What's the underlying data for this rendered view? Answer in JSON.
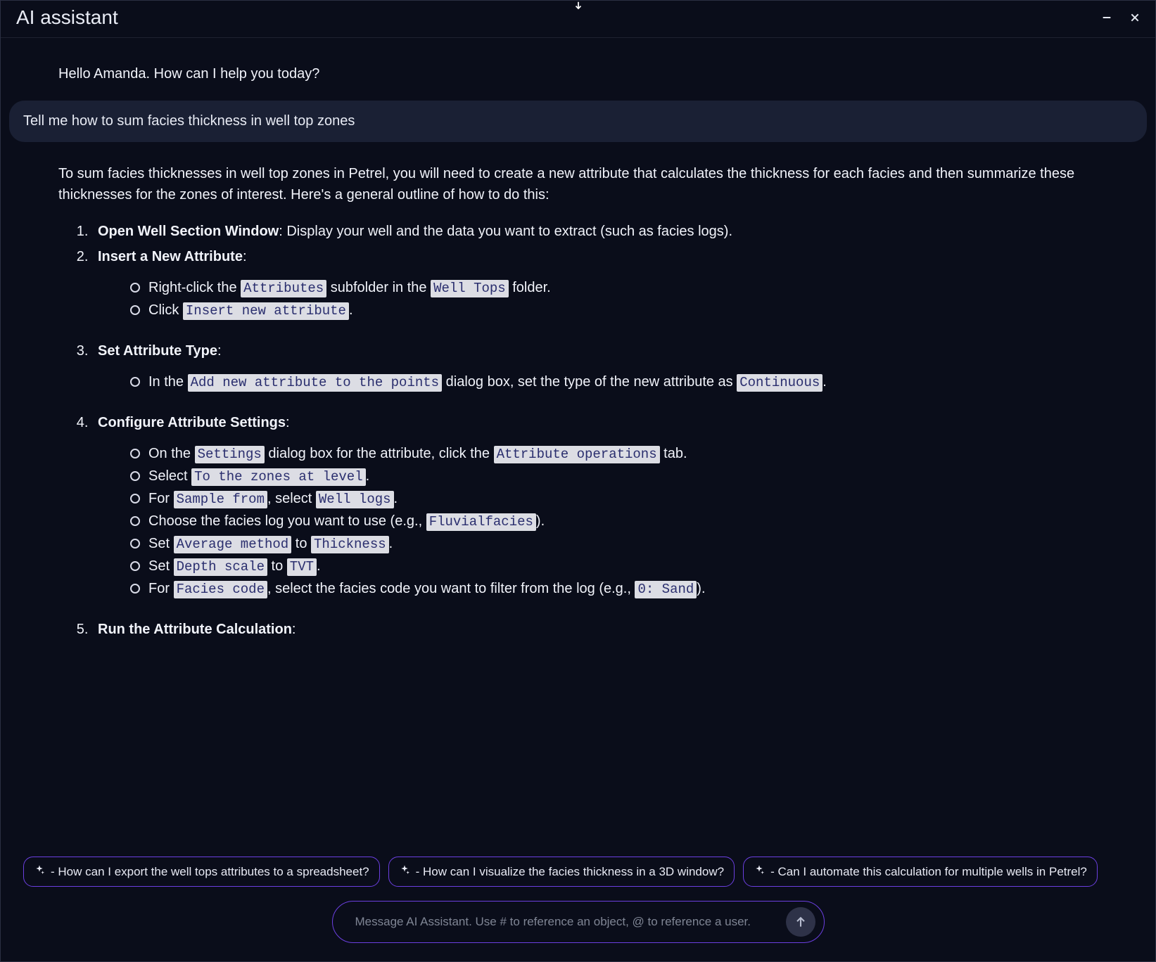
{
  "window": {
    "title": "AI assistant"
  },
  "chat": {
    "greeting": "Hello Amanda. How can I help you today?",
    "user_message": "Tell me how to sum facies thickness in well top zones",
    "answer_intro": "To sum facies thicknesses in well top zones in Petrel, you will need to create a new attribute that calculates the thickness for each facies and then summarize these thicknesses for the zones of interest. Here's a general outline of how to do this:",
    "steps": {
      "s1_title": "Open Well Section Window",
      "s1_tail": ": Display your well and the data you want to extract (such as facies logs).",
      "s2_title": "Insert a New Attribute",
      "s2_tail": ":",
      "s2_a_pre": "Right-click the ",
      "s2_a_c1": "Attributes",
      "s2_a_mid": " subfolder in the ",
      "s2_a_c2": "Well Tops",
      "s2_a_post": " folder.",
      "s2_b_pre": "Click ",
      "s2_b_c1": "Insert new attribute",
      "s2_b_post": ".",
      "s3_title": "Set Attribute Type",
      "s3_tail": ":",
      "s3_a_pre": "In the ",
      "s3_a_c1": "Add new attribute to the points",
      "s3_a_mid": " dialog box, set the type of the new attribute as ",
      "s3_a_c2": "Continuous",
      "s3_a_post": ".",
      "s4_title": "Configure Attribute Settings",
      "s4_tail": ":",
      "s4_a_pre": "On the ",
      "s4_a_c1": "Settings",
      "s4_a_mid": " dialog box for the attribute, click the ",
      "s4_a_c2": "Attribute operations",
      "s4_a_post": " tab.",
      "s4_b_pre": "Select ",
      "s4_b_c1": "To the zones at level",
      "s4_b_post": ".",
      "s4_c_pre": "For ",
      "s4_c_c1": "Sample from",
      "s4_c_mid": ", select ",
      "s4_c_c2": "Well logs",
      "s4_c_post": ".",
      "s4_d_pre": "Choose the facies log you want to use (e.g., ",
      "s4_d_c1": "Fluvialfacies",
      "s4_d_post": ").",
      "s4_e_pre": "Set ",
      "s4_e_c1": "Average method",
      "s4_e_mid": " to ",
      "s4_e_c2": "Thickness",
      "s4_e_post": ".",
      "s4_f_pre": "Set ",
      "s4_f_c1": "Depth scale",
      "s4_f_mid": " to ",
      "s4_f_c2": "TVT",
      "s4_f_post": ".",
      "s4_g_pre": "For ",
      "s4_g_c1": "Facies code",
      "s4_g_mid": ", select the facies code you want to filter from the log (e.g., ",
      "s4_g_c2": "0: Sand",
      "s4_g_post": ").",
      "s5_title": "Run the Attribute Calculation",
      "s5_tail": ":"
    }
  },
  "suggestions": {
    "s1": " - How can I export the well tops attributes to a spreadsheet?",
    "s2": " - How can I visualize the facies thickness in a 3D window?",
    "s3": " - Can I automate this calculation for multiple wells in Petrel?"
  },
  "input": {
    "placeholder": "Message AI Assistant. Use # to reference an object, @ to reference a user."
  }
}
